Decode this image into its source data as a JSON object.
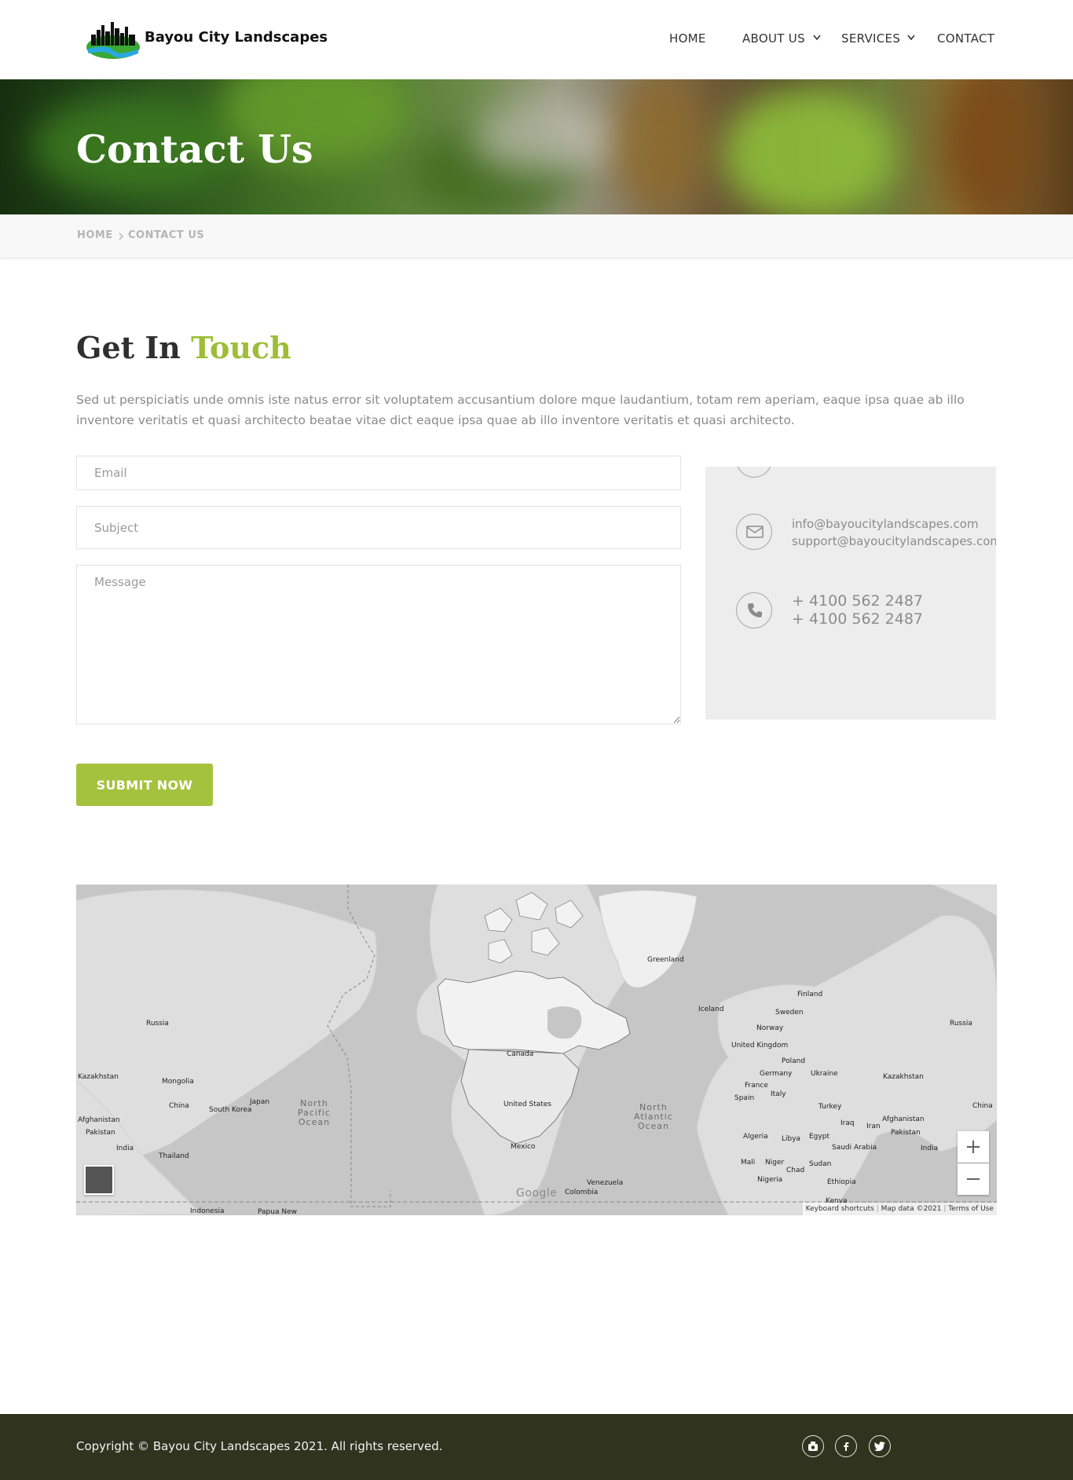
{
  "header": {
    "brand": "Bayou City Landscapes",
    "nav": [
      {
        "label": "HOME"
      },
      {
        "label": "ABOUT US"
      },
      {
        "label": "SERVICES"
      },
      {
        "label": "CONTACT"
      }
    ]
  },
  "hero": {
    "title": "Contact Us"
  },
  "breadcrumb": {
    "home": "HOME",
    "current": "CONTACT US"
  },
  "intro": {
    "title_part1": "Get In",
    "title_part2": "Touch",
    "text": "Sed ut perspiciatis unde omnis iste natus error sit voluptatem accusantium dolore mque laudantium, totam rem aperiam, eaque ipsa quae ab illo inventore veritatis et quasi architecto beatae vitae dict eaque ipsa quae ab illo inventore veritatis et quasi architecto."
  },
  "form": {
    "email_placeholder": "Email",
    "subject_placeholder": "Subject",
    "message_placeholder": "Message",
    "submit_label": "SUBMIT NOW"
  },
  "contact": {
    "emails": [
      "info@bayoucitylandscapes.com",
      "support@bayoucitylandscapes.com"
    ],
    "phones": [
      "+ 4100 562 2487",
      "+ 4100 562 2487"
    ]
  },
  "map": {
    "labels": [
      "Greenland",
      "Iceland",
      "Finland",
      "Sweden",
      "Norway",
      "Russia",
      "Russia",
      "United Kingdom",
      "Poland",
      "Germany",
      "Ukraine",
      "France",
      "Spain",
      "Italy",
      "Turkey",
      "Kazakhstan",
      "Kazakhstan",
      "Mongolia",
      "China",
      "China",
      "Japan",
      "South Korea",
      "Afghanistan",
      "Afghanistan",
      "Pakistan",
      "Pakistan",
      "India",
      "India",
      "Thailand",
      "Indonesia",
      "Papua New",
      "Canada",
      "United States",
      "Mexico",
      "Venezuela",
      "Colombia",
      "Algeria",
      "Libya",
      "Egypt",
      "Iraq",
      "Iran",
      "Saudi Arabia",
      "Mali",
      "Niger",
      "Chad",
      "Sudan",
      "Nigeria",
      "Ethiopia",
      "Kenya"
    ],
    "oceans": [
      "North\nPacific\nOcean",
      "North\nAtlantic\nOcean"
    ],
    "google": "Google",
    "footer_links": [
      "Keyboard shortcuts",
      "Map data ©2021",
      "Terms of Use"
    ],
    "zoom_in": "+",
    "zoom_out": "−"
  },
  "footer": {
    "copyright": "Copyright © Bayou City Landscapes 2021. All rights reserved."
  },
  "colors": {
    "accent": "#a5c23f",
    "footer_bg": "#30341f",
    "title_accent": "#9dbd36"
  },
  "icons": [
    "logo-icon",
    "chevron-down-icon",
    "envelope-icon",
    "phone-icon",
    "map-layer-icon",
    "instagram-icon",
    "facebook-icon",
    "twitter-icon"
  ]
}
